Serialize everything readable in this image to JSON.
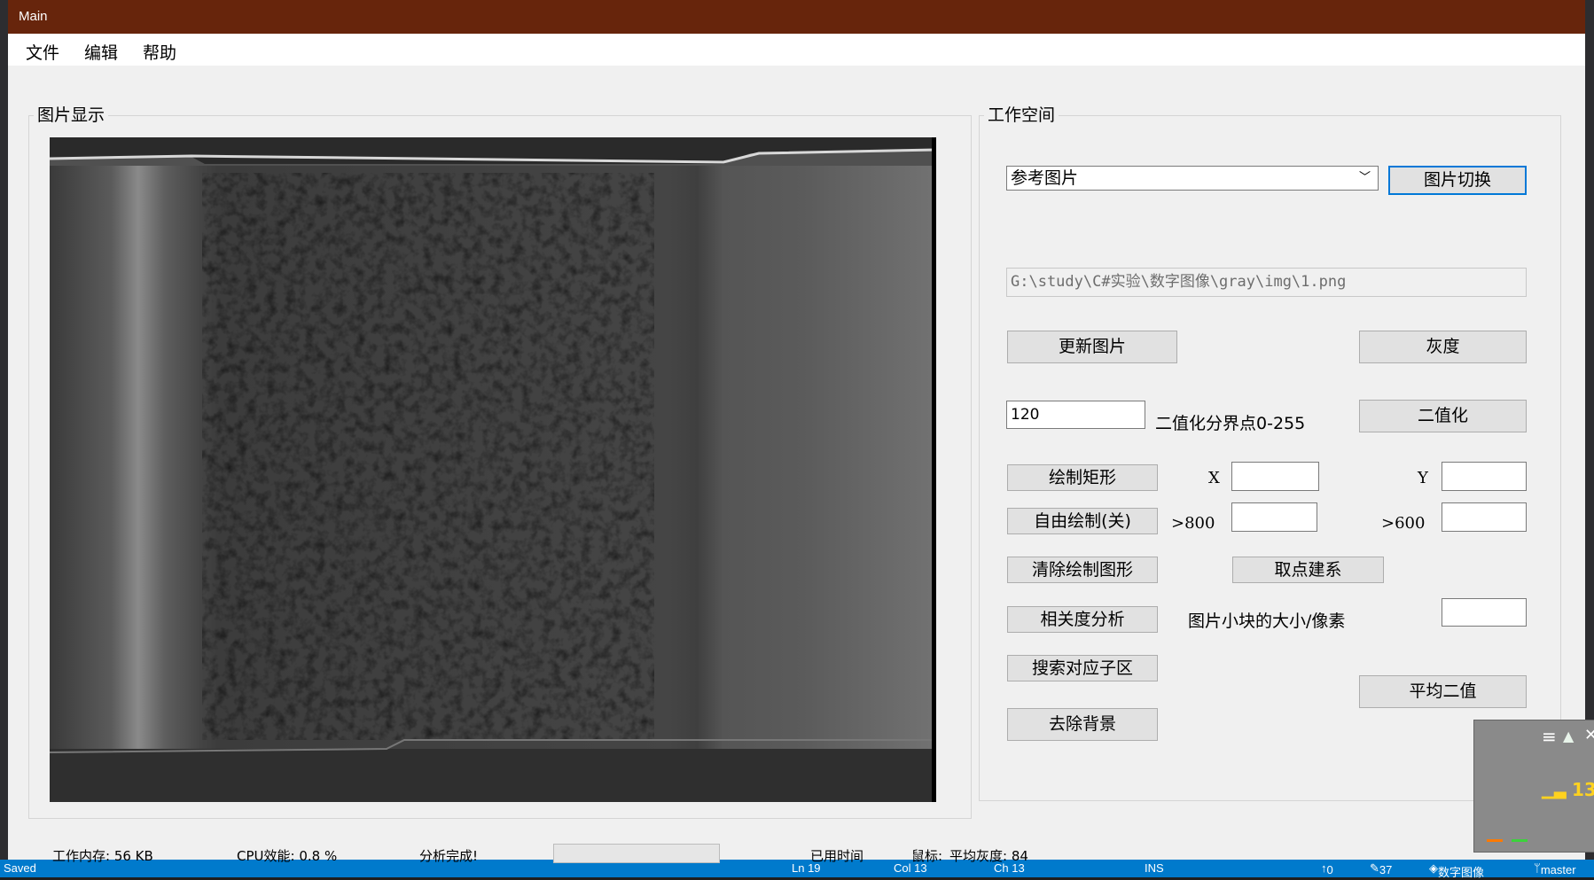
{
  "window": {
    "title": "Main"
  },
  "menu": [
    "文件",
    "编辑",
    "帮助"
  ],
  "image_panel": {
    "title": "图片显示"
  },
  "workspace": {
    "title": "工作空间",
    "image_select": {
      "value": "参考图片"
    },
    "switch_button": "图片切换",
    "path_field": {
      "value": "G:\\study\\C#实验\\数字图像\\gray\\img\\1.png"
    },
    "update_button": "更新图片",
    "gray_button": "灰度",
    "threshold_field": {
      "value": "120"
    },
    "threshold_label": "二值化分界点0-255",
    "binarize_button": "二值化",
    "draw_rect_button": "绘制矩形",
    "x_label": "X",
    "y_label": "Y",
    "free_draw_button": "自由绘制(关)",
    "x_limit_label": ">800",
    "y_limit_label": ">600",
    "clear_button": "清除绘制图形",
    "coord_button": "取点建系",
    "correlation_button": "相关度分析",
    "block_size_label": "图片小块的大小/像素",
    "search_button": "搜索对应子区",
    "average_binary_button": "平均二值",
    "remove_bg_button": "去除背景"
  },
  "status": {
    "memory": "工作内存: 56 KB",
    "cpu": "CPU效能: 0.8 %",
    "message": "分析完成!",
    "elapsed": "已用时间",
    "mouse": "鼠标:",
    "avg_gray": "平均灰度: 84"
  },
  "ide_status": {
    "saved": "Saved",
    "ln": "Ln 19",
    "col": "Col 13",
    "ch": "Ch 13",
    "ins": "INS",
    "up": "0",
    "edits": "37",
    "repo": "数字图像",
    "branch": "master"
  },
  "overlay": {
    "number": "13"
  },
  "colors": {
    "titlebar": "#67250c",
    "accent": "#0078d7",
    "ide_status": "#007acc"
  }
}
